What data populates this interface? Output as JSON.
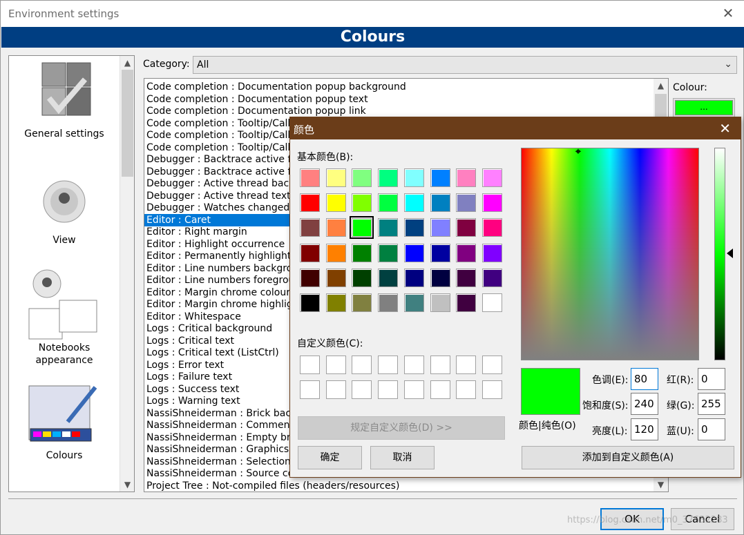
{
  "window": {
    "title": "Environment settings",
    "close": "✕",
    "banner": "Colours"
  },
  "sidebar": {
    "items": [
      {
        "label": "General settings"
      },
      {
        "label": "View"
      },
      {
        "label": "Notebooks appearance"
      },
      {
        "label": "Colours"
      }
    ]
  },
  "category": {
    "label": "Category:",
    "value": "All"
  },
  "colour": {
    "label": "Colour:",
    "button": "...",
    "value": "#00ff00"
  },
  "list": {
    "rows": [
      "Code completion : Documentation popup background",
      "Code completion : Documentation popup text",
      "Code completion : Documentation popup link",
      "Code completion : Tooltip/Call",
      "Code completion : Tooltip/Call",
      "Code completion : Tooltip/Call",
      "Debugger : Backtrace active fr",
      "Debugger : Backtrace active fr",
      "Debugger : Active thread back",
      "Debugger : Active thread text",
      "Debugger : Watches changed",
      "Editor : Caret",
      "Editor : Right margin",
      "Editor : Highlight occurrence",
      "Editor : Permanently highlighte",
      "Editor : Line numbers backgro",
      "Editor : Line numbers foregrou",
      "Editor : Margin chrome colour",
      "Editor : Margin chrome highligh",
      "Editor : Whitespace",
      "Logs : Critical background",
      "Logs : Critical text",
      "Logs : Critical text (ListCtrl)",
      "Logs : Error text",
      "Logs : Failure text",
      "Logs : Success text",
      "Logs : Warning text",
      "NassiShneiderman : Brick backg",
      "NassiShneiderman : Comment",
      "NassiShneiderman : Empty bric",
      "NassiShneiderman : Graphics c",
      "NassiShneiderman : Selection c",
      "NassiShneiderman : Source co",
      "Project Tree : Not-compiled files (headers/resources)"
    ],
    "selected_index": 11
  },
  "buttons": {
    "ok": "OK",
    "cancel": "Cancel"
  },
  "watermark": "https://blog.csdn.net/m0_37632283",
  "dialog": {
    "title": "颜色",
    "basic_label": "基本颜色(B):",
    "custom_label": "自定义颜色(C):",
    "define_custom": "规定自定义颜色(D) >>",
    "ok": "确定",
    "cancel": "取消",
    "add_custom": "添加到自定义颜色(A)",
    "preview_label": "颜色|纯色(O)",
    "hue_label": "色调(E):",
    "hue": "80",
    "sat_label": "饱和度(S):",
    "sat": "240",
    "lum_label": "亮度(L):",
    "lum": "120",
    "red_label": "红(R):",
    "red": "0",
    "green_label": "绿(G):",
    "green": "255",
    "blue_label": "蓝(U):",
    "blue": "0",
    "basic_colors": [
      "#ff8080",
      "#ffff80",
      "#80ff80",
      "#00ff80",
      "#80ffff",
      "#0080ff",
      "#ff80c0",
      "#ff80ff",
      "#ff0000",
      "#ffff00",
      "#80ff00",
      "#00ff40",
      "#00ffff",
      "#0080c0",
      "#8080c0",
      "#ff00ff",
      "#804040",
      "#ff8040",
      "#00ff00",
      "#008080",
      "#004080",
      "#8080ff",
      "#800040",
      "#ff0080",
      "#800000",
      "#ff8000",
      "#008000",
      "#008040",
      "#0000ff",
      "#0000a0",
      "#800080",
      "#8000ff",
      "#400000",
      "#804000",
      "#004000",
      "#004040",
      "#000080",
      "#000040",
      "#400040",
      "#400080",
      "#000000",
      "#808000",
      "#808040",
      "#808080",
      "#408080",
      "#c0c0c0",
      "#400040",
      "#ffffff"
    ],
    "selected_basic_index": 18
  }
}
